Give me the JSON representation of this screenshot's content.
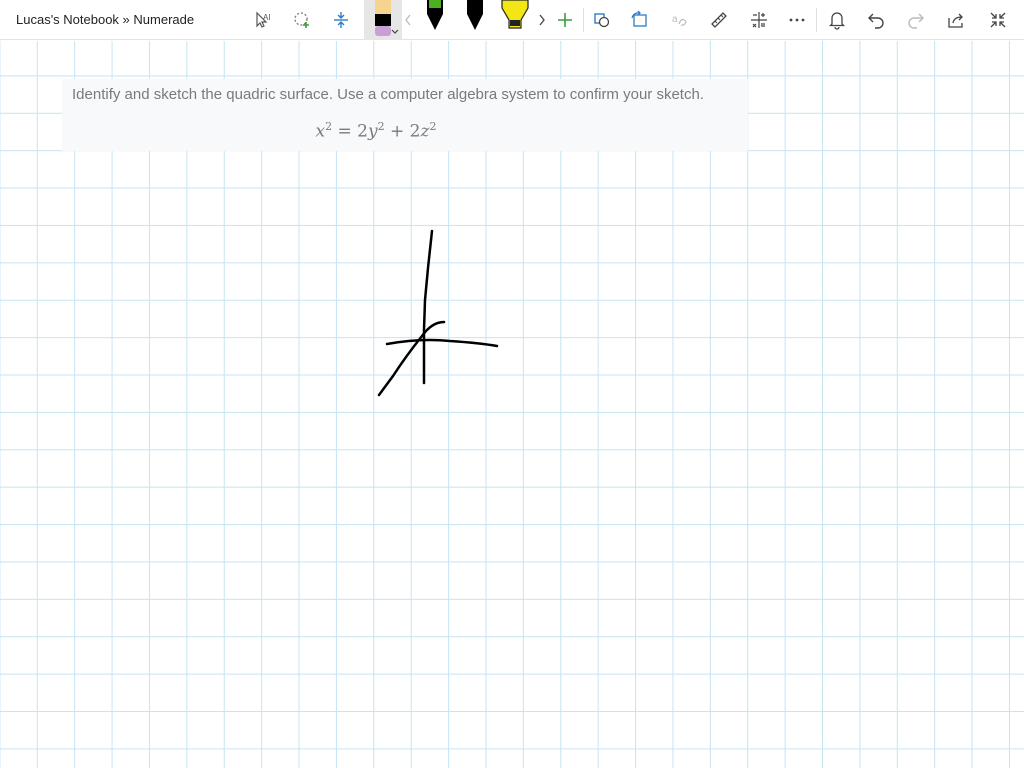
{
  "header": {
    "breadcrumb": "Lucas's Notebook » Numerade"
  },
  "toolbar": {
    "tools": [
      {
        "name": "lasso-select-icon"
      },
      {
        "name": "add-space-icon"
      },
      {
        "name": "insert-space-icon"
      },
      {
        "name": "pen-icon"
      },
      {
        "name": "pen-green-icon"
      },
      {
        "name": "pen-black-icon"
      },
      {
        "name": "highlighter-yellow-icon"
      },
      {
        "name": "add-pen-icon"
      },
      {
        "name": "shapes-icon"
      },
      {
        "name": "ink-to-shape-icon"
      },
      {
        "name": "ink-to-text-icon"
      },
      {
        "name": "ruler-icon"
      },
      {
        "name": "math-icon"
      },
      {
        "name": "more-icon"
      },
      {
        "name": "bell-icon"
      },
      {
        "name": "undo-icon"
      },
      {
        "name": "redo-icon"
      },
      {
        "name": "share-icon"
      },
      {
        "name": "collapse-icon"
      }
    ],
    "colors": {
      "pen_selected_top": "#f5d58e",
      "pen_selected_bottom": "#c8a0d6",
      "pen_green": "#4caf1f",
      "highlighter_yellow": "#f3e614",
      "accent_green": "#3a9d3a",
      "accent_blue": "#2f7dc4"
    }
  },
  "problem": {
    "text": "Identify and sketch the quadric surface. Use a computer algebra system to confirm your sketch.",
    "equation": {
      "lhs_base": "x",
      "lhs_exp": "2",
      "eq": " = 2",
      "t1_base": "y",
      "t1_exp": "2",
      "plus": " + 2",
      "t2_base": "z",
      "t2_exp": "2"
    }
  },
  "canvas": {
    "grid_color": "#c6e4f3",
    "ink_color": "#000000"
  }
}
